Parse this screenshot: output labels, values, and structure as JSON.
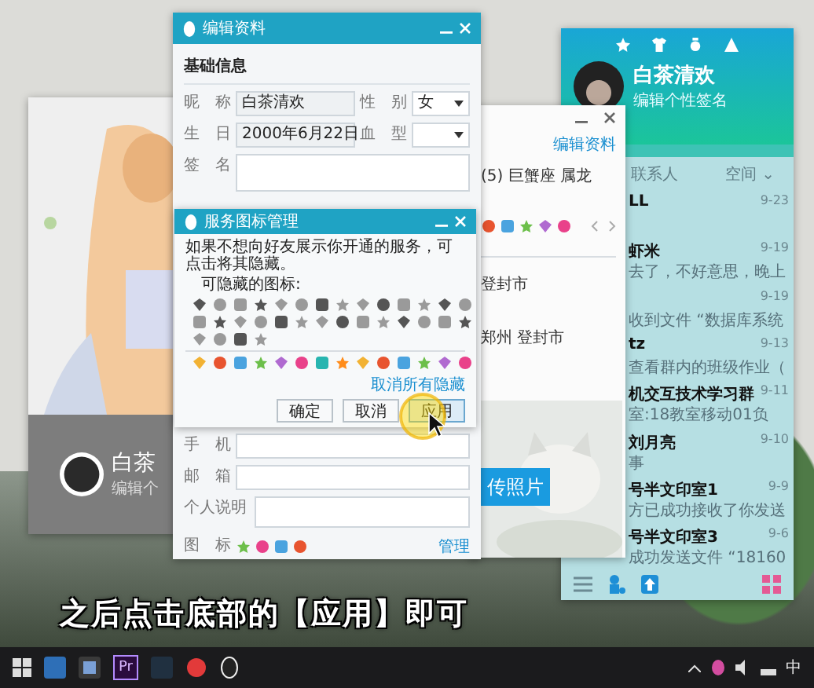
{
  "profile_card": {
    "name": "白茶",
    "signature": "编辑个"
  },
  "profile_window": {
    "edit_link": "编辑资料",
    "info": "(5)  巨蟹座  属龙",
    "location_1": "登封市",
    "location_2": "郑州 登封市",
    "upload_button": "传照片"
  },
  "main_panel": {
    "name": "白茶清欢",
    "signature": "编辑个性签名",
    "tabs": [
      {
        "label": "联系人",
        "selected": false
      },
      {
        "label": "空间 ⌄",
        "selected": false
      }
    ],
    "chats": [
      {
        "name": "LL",
        "time": "9-23"
      },
      {
        "name": "虾米",
        "time": "9-19",
        "preview": "去了，不好意思，晚上"
      },
      {
        "time": "9-19",
        "preview": "收到文件 “数据库系统"
      },
      {
        "name": "tz",
        "time": "9-13",
        "preview": "查看群内的班级作业（"
      },
      {
        "name": "机交互技术学习群",
        "time": "9-11",
        "preview": "室:18教室移动01负"
      },
      {
        "name": "刘月亮",
        "time": "9-10",
        "preview": "事"
      },
      {
        "name": "号半文印室1",
        "time": "9-9",
        "preview": "方已成功接收了你发送"
      },
      {
        "name": "号半文印室3",
        "time": "9-6",
        "preview": "成功发送文件 “18160"
      }
    ]
  },
  "edit_window": {
    "title": "编辑资料",
    "section": "基础信息",
    "rows": [
      [
        {
          "label": "昵　称",
          "value": "白茶清欢",
          "kind": "text"
        },
        {
          "label": "性　别",
          "value": "女",
          "kind": "select"
        }
      ],
      [
        {
          "label": "生　日",
          "value": "2000年6月22日",
          "kind": "text"
        },
        {
          "label": "血　型",
          "kind": "select"
        }
      ],
      [
        {
          "label": "签　名",
          "kind": "area"
        }
      ]
    ],
    "lower_rows": [
      [
        {
          "label": "手　机",
          "kind": "text"
        }
      ],
      [
        {
          "label": "邮　箱",
          "kind": "text"
        }
      ],
      [
        {
          "label": "个人说明",
          "kind": "area"
        }
      ]
    ],
    "icons_label": "图　标",
    "manage_link": "管理"
  },
  "dialog": {
    "title": "服务图标管理",
    "message": "如果不想向好友展示你开通的服务，可点击将其隐藏。",
    "hidden_label": "可隐藏的图标:",
    "unhide_link": "取消所有隐藏",
    "buttons": [
      {
        "label": "确定",
        "pressed": false
      },
      {
        "label": "取消",
        "pressed": false
      },
      {
        "label": "应用",
        "pressed": true
      }
    ]
  },
  "subtitle": "之后点击底部的【应用】即可",
  "taskbar": {
    "premiere_label": "Pr",
    "ime": "中"
  }
}
